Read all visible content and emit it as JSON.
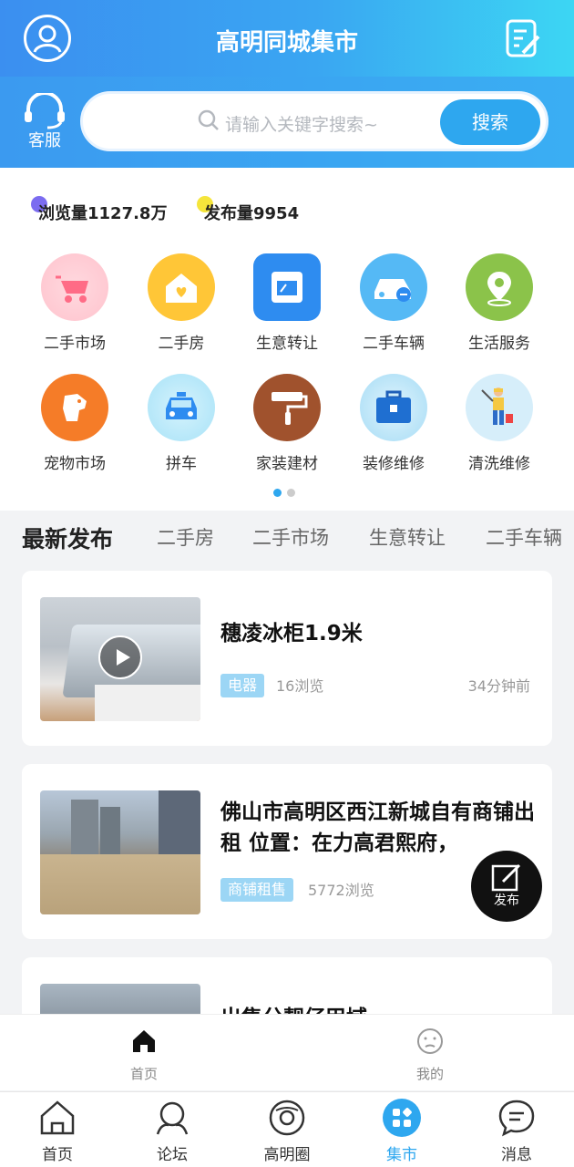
{
  "header": {
    "title": "高明同城集市"
  },
  "search": {
    "service_label": "客服",
    "placeholder": "请输入关键字搜索~",
    "button_label": "搜索"
  },
  "stats": {
    "views": "浏览量1127.8万",
    "posts": "发布量9954",
    "views_dot_color": "#7b6cf0",
    "posts_dot_color": "#f5e53b"
  },
  "categories": [
    {
      "label": "二手市场",
      "icon": "stroller-icon",
      "color": "#ffc9d2"
    },
    {
      "label": "二手房",
      "icon": "house-heart-icon",
      "color": "#ffc637"
    },
    {
      "label": "生意转让",
      "icon": "shop-icon",
      "color": "#2e8cf0"
    },
    {
      "label": "二手车辆",
      "icon": "car-icon",
      "color": "#55b9f5"
    },
    {
      "label": "生活服务",
      "icon": "location-pin-icon",
      "color": "#8bc34a"
    },
    {
      "label": "宠物市场",
      "icon": "dog-icon",
      "color": "#f57c28"
    },
    {
      "label": "拼车",
      "icon": "taxi-icon",
      "color": "#a7e2f7"
    },
    {
      "label": "家装建材",
      "icon": "paint-roller-icon",
      "color": "#a0522d"
    },
    {
      "label": "装修维修",
      "icon": "toolbox-icon",
      "color": "#a6dcf5"
    },
    {
      "label": "清洗维修",
      "icon": "cleaner-worker-icon",
      "color": "#d6eefa"
    }
  ],
  "tabs": [
    "最新发布",
    "二手房",
    "二手市场",
    "生意转让",
    "二手车辆"
  ],
  "listings": [
    {
      "title": "穗凌冰柜1.9米",
      "tag": "电器",
      "views": "16浏览",
      "time": "34分钟前"
    },
    {
      "title": "佛山市高明区西江新城自有商铺出租 位置：在力高君熙府，",
      "tag": "商铺租售",
      "views": "5772浏览",
      "time": ""
    },
    {
      "title": "出售分靓仔甲域",
      "tag": "",
      "views": "",
      "time": ""
    }
  ],
  "fab": {
    "label": "发布"
  },
  "inner_bar": {
    "home": "首页",
    "mine": "我的"
  },
  "bottom_nav": [
    {
      "label": "首页",
      "icon": "home-icon"
    },
    {
      "label": "论坛",
      "icon": "forum-icon"
    },
    {
      "label": "高明圈",
      "icon": "circle-icon"
    },
    {
      "label": "集市",
      "icon": "market-icon",
      "active": true
    },
    {
      "label": "消息",
      "icon": "message-icon"
    }
  ],
  "colors": {
    "accent": "#2ea7ef",
    "header_start": "#3b8ff0",
    "header_end": "#3cd6f3"
  }
}
